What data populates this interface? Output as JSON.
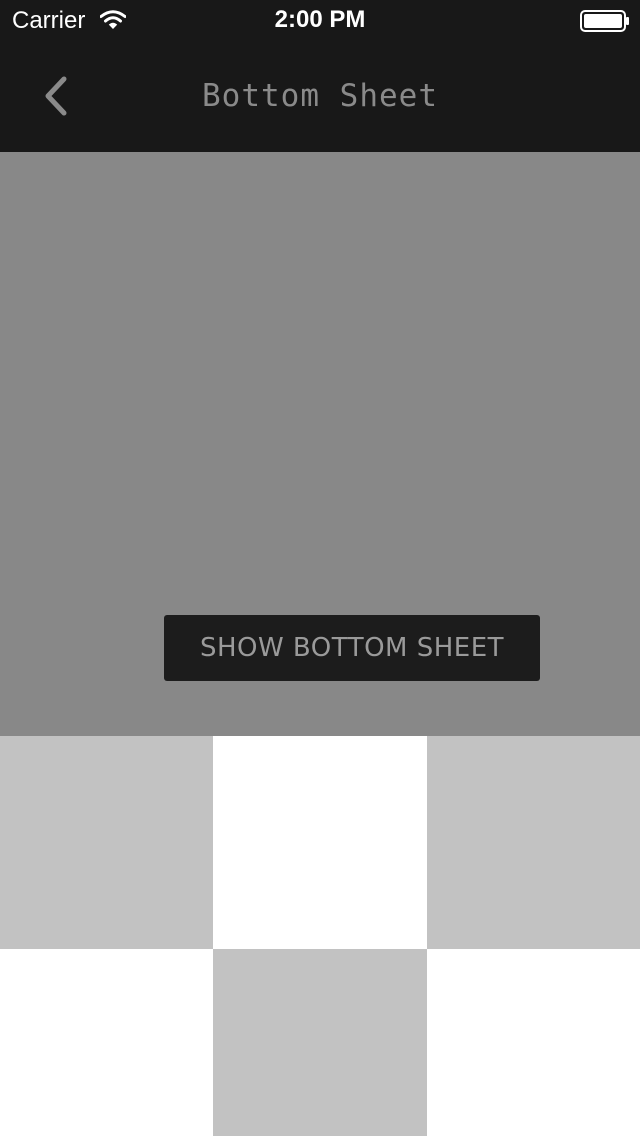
{
  "status_bar": {
    "carrier": "Carrier",
    "time": "2:00 PM",
    "wifi_icon": "wifi-icon",
    "battery_icon": "battery-icon"
  },
  "nav_bar": {
    "title": "Bottom Sheet",
    "back_icon": "chevron-left-icon"
  },
  "content": {
    "show_button_label": "SHOW BOTTOM SHEET"
  },
  "grid": {
    "columns": 3,
    "cells": [
      {
        "color": "gray"
      },
      {
        "color": "white"
      },
      {
        "color": "gray"
      },
      {
        "color": "white"
      },
      {
        "color": "gray"
      },
      {
        "color": "white"
      }
    ]
  },
  "colors": {
    "bar_background": "#181818",
    "content_background": "#888888",
    "button_background": "#1c1c1c",
    "tile_gray": "#c2c2c2",
    "tile_white": "#ffffff"
  }
}
